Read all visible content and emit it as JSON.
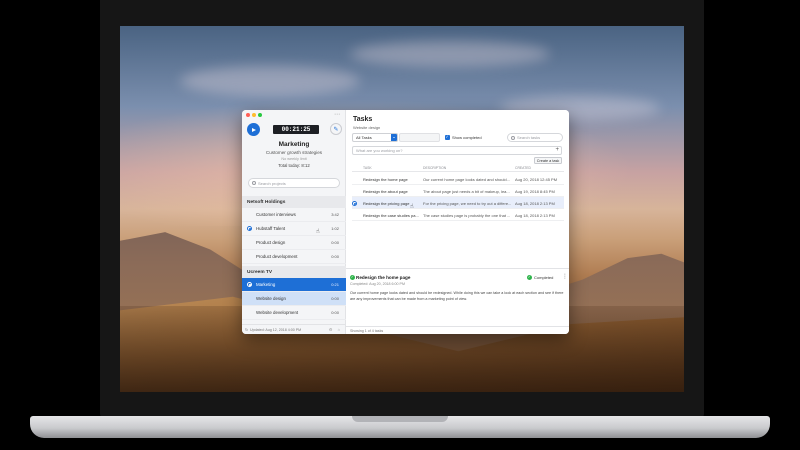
{
  "sidebar": {
    "timer": "00:21:25",
    "project_title": "Marketing",
    "project_subtitle": "Customer growth strategies",
    "weekly_limit": "No weekly limit",
    "total_today": "Total today: 8:12",
    "search_placeholder": "Search projects",
    "groups": [
      {
        "name": "Netsoft Holdings",
        "items": [
          {
            "label": "Customer interviews",
            "hours": "3:42"
          },
          {
            "label": "Hubstaff Talent",
            "hours": "1:02"
          },
          {
            "label": "Product design",
            "hours": "0:00"
          },
          {
            "label": "Product development",
            "hours": "0:00"
          }
        ]
      },
      {
        "name": "Ucreem TV",
        "items": [
          {
            "label": "Marketing",
            "hours": "0:21"
          },
          {
            "label": "Website design",
            "hours": "0:00"
          },
          {
            "label": "Website development",
            "hours": "0:00"
          }
        ]
      }
    ],
    "footer_updated": "Updated: Aug 12, 2018 4:00 PM"
  },
  "main": {
    "title": "Tasks",
    "subtitle": "Website design",
    "filter_value": "All Tasks",
    "show_completed_label": "Show completed",
    "search_placeholder": "Search tasks",
    "new_task_placeholder": "What are you working on?",
    "create_button": "Create a task",
    "columns": {
      "task": "TASK",
      "description": "DESCRIPTION",
      "created": "CREATED"
    },
    "rows": [
      {
        "task": "Redesign the home page",
        "description": "Our current home page looks dated and should...",
        "created": "Aug 20, 2018 12:45 PM"
      },
      {
        "task": "Redesign the about page",
        "description": "The about page just needs a bit of makeup, lea...",
        "created": "Aug 19, 2018 8:45 PM"
      },
      {
        "task": "Redesign the pricing page",
        "description": "For the pricing page, we need to try out a differe...",
        "created": "Aug 18, 2018 2:13 PM"
      },
      {
        "task": "Redesign the case studies pa...",
        "description": "The case studies page is probably the one that ...",
        "created": "Aug 18, 2018 2:13 PM"
      }
    ],
    "detail": {
      "title": "Redesign the home page",
      "completed_on": "Completed: Aug 20, 2018 6:00 PM",
      "status": "Completed",
      "text": "Our current home page looks dated and should be redesigned. While doing this we can take a look at each section and see if there are any improvements that can be made from a marketing point of view."
    },
    "footer": "Showing 1 of 4 tasks"
  },
  "colors": {
    "accent": "#1e6fd6",
    "success": "#2db34a"
  }
}
